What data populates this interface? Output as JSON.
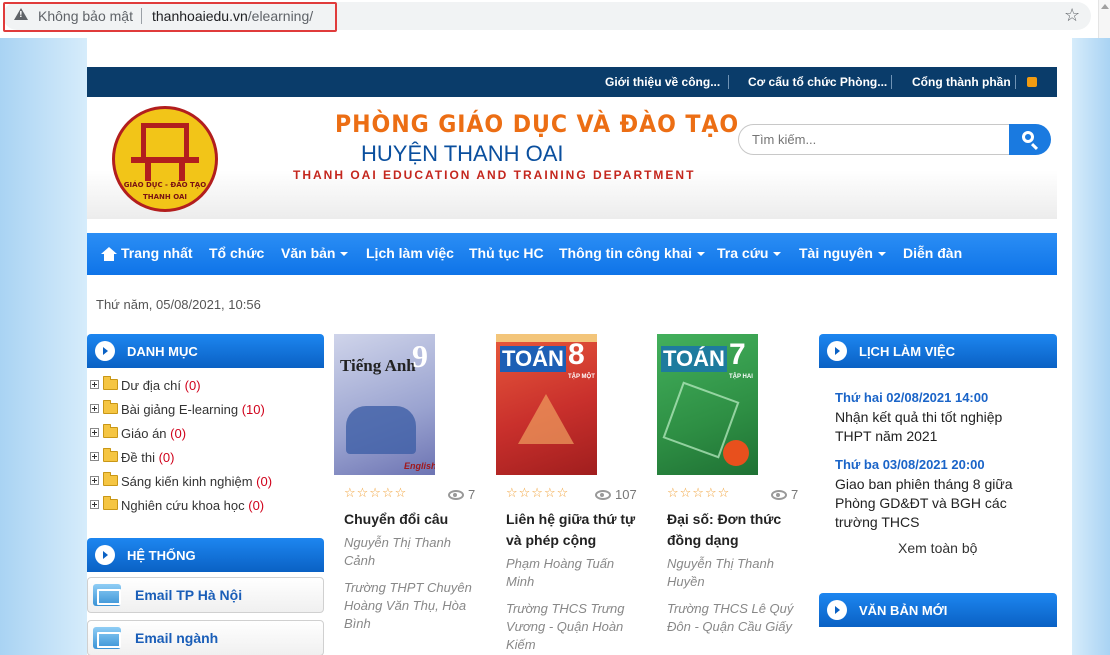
{
  "browser": {
    "not_secure": "Không bảo mật",
    "url_host": "thanhoaiedu.vn",
    "url_path": "/elearning/"
  },
  "topbar": {
    "links": [
      "Giới thiệu về công...",
      "Cơ cấu tổ chức Phòng...",
      "Cổng thành phần"
    ]
  },
  "header": {
    "logo_line1": "GIÁO DỤC - ĐÀO TẠO",
    "logo_line2": "THANH OAI",
    "title1": "PHÒNG GIÁO DỤC VÀ ĐÀO TẠO",
    "title2": "HUYỆN THANH OAI",
    "title3": "THANH OAI EDUCATION AND TRAINING DEPARTMENT",
    "search_placeholder": "Tìm kiếm..."
  },
  "nav": {
    "items": [
      {
        "label": "Trang nhất"
      },
      {
        "label": "Tổ chức"
      },
      {
        "label": "Văn bản"
      },
      {
        "label": "Lịch làm việc"
      },
      {
        "label": "Thủ tục HC"
      },
      {
        "label": "Thông tin công khai"
      },
      {
        "label": "Tra cứu"
      },
      {
        "label": "Tài nguyên"
      },
      {
        "label": "Diễn đàn"
      }
    ]
  },
  "datetime": "Thứ năm, 05/08/2021, 10:56",
  "danhmuc": {
    "title": "DANH MỤC",
    "items": [
      {
        "label": "Dư địa chí",
        "count": "(0)"
      },
      {
        "label": "Bài giảng E-learning",
        "count": "(10)"
      },
      {
        "label": "Giáo án",
        "count": "(0)"
      },
      {
        "label": "Đề thi",
        "count": "(0)"
      },
      {
        "label": "Sáng kiến kinh nghiệm",
        "count": "(0)"
      },
      {
        "label": "Nghiên cứu khoa học",
        "count": "(0)"
      }
    ]
  },
  "hethong": {
    "title": "HỆ THỐNG",
    "links": [
      "Email TP Hà Nội",
      "Email ngành"
    ]
  },
  "books": [
    {
      "cover_title": "Tiếng Anh",
      "cover_num": "9",
      "cover_sub": "English",
      "stars": "☆☆☆☆☆",
      "views": "7",
      "title": "Chuyển đổi câu",
      "author": "Nguyễn Thị Thanh Cảnh",
      "school": "Trường THPT Chuyên Hoàng Văn Thụ, Hòa Bình"
    },
    {
      "cover_title": "TOÁN",
      "cover_num": "8",
      "cover_sub": "TẬP MỘT",
      "stars": "☆☆☆☆☆",
      "views": "107",
      "title": "Liên hệ giữa thứ tự và phép cộng",
      "author": "Phạm Hoàng Tuấn Minh",
      "school": "Trường THCS Trưng Vương - Quận Hoàn Kiếm"
    },
    {
      "cover_title": "TOÁN",
      "cover_num": "7",
      "cover_sub": "TẬP HAI",
      "stars": "☆☆☆☆☆",
      "views": "7",
      "title": "Đại số: Đơn thức đồng dạng",
      "author": "Nguyễn Thị Thanh Huyền",
      "school": "Trường THCS Lê Quý Đôn - Quận Cầu Giấy"
    }
  ],
  "lich": {
    "title": "LỊCH LÀM VIỆC",
    "entries": [
      {
        "date": "Thứ hai 02/08/2021 14:00",
        "text": "Nhận kết quả thi tốt nghiệp THPT năm 2021"
      },
      {
        "date": "Thứ ba 03/08/2021 20:00",
        "text": "Giao ban phiên tháng 8 giữa Phòng GD&ĐT và BGH các trường THCS"
      }
    ],
    "see_all": "Xem toàn bộ"
  },
  "vanban": {
    "title": "VĂN BẢN MỚI"
  },
  "colors": {
    "nav_blue": "#1a7ae0",
    "top_navy": "#0a3c6a",
    "title_orange": "#ec6e14",
    "count_red": "#d0021b"
  },
  "icons": [
    "warning-icon",
    "star-icon",
    "rss-icon",
    "home-icon",
    "search-icon",
    "folder-icon",
    "mail-icon",
    "eye-icon"
  ]
}
